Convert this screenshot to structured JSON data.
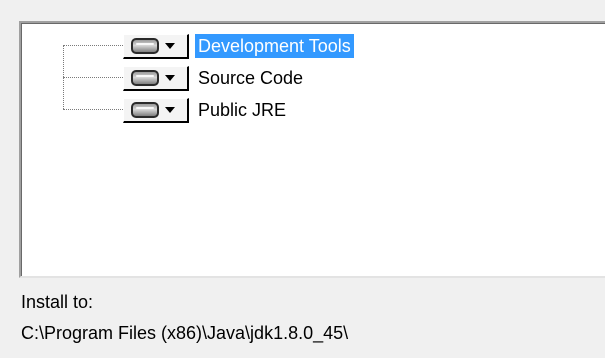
{
  "feature_tree": {
    "items": [
      {
        "label": "Development Tools",
        "icon": "hard-drive-icon",
        "selected": true
      },
      {
        "label": "Source Code",
        "icon": "hard-drive-icon",
        "selected": false
      },
      {
        "label": "Public JRE",
        "icon": "hard-drive-icon",
        "selected": false
      }
    ],
    "selection_color": "#3399ff"
  },
  "install": {
    "label": "Install to:",
    "path": "C:\\Program Files (x86)\\Java\\jdk1.8.0_45\\"
  }
}
